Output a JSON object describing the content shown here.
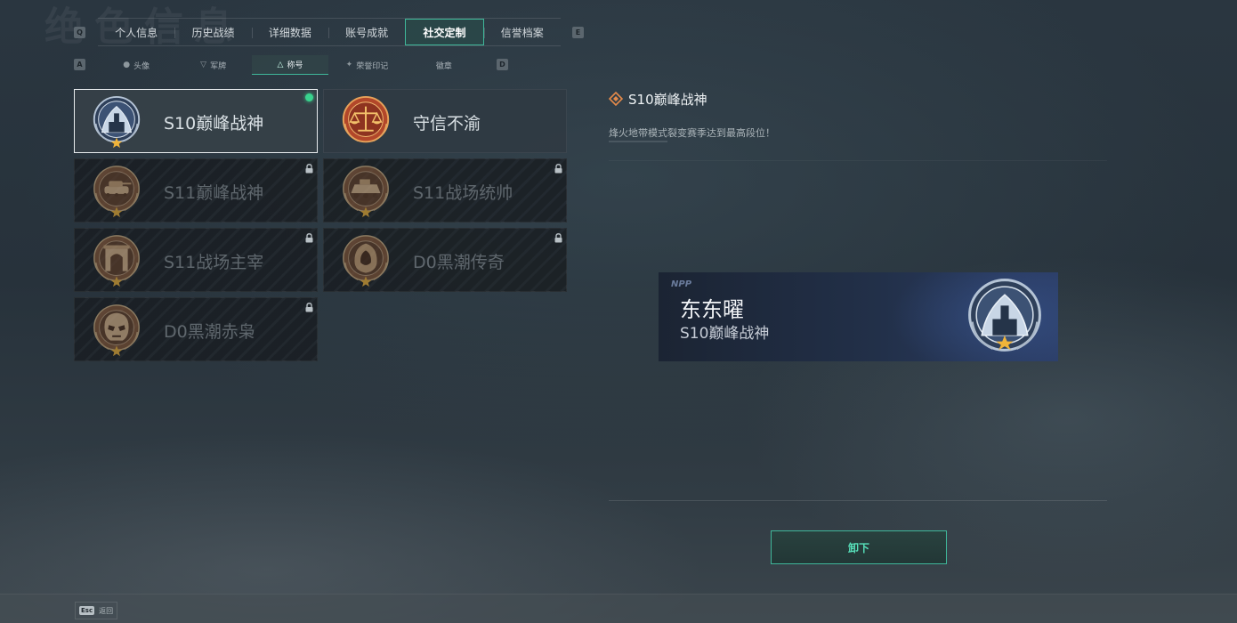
{
  "header": {
    "background_title": "绝色信息",
    "left_key": "Q",
    "right_key": "E",
    "tabs": [
      {
        "label": "个人信息",
        "active": false
      },
      {
        "label": "历史战绩",
        "active": false
      },
      {
        "label": "详细数据",
        "active": false
      },
      {
        "label": "账号成就",
        "active": false
      },
      {
        "label": "社交定制",
        "active": true
      },
      {
        "label": "信誉档案",
        "active": false
      }
    ]
  },
  "sub_nav": {
    "left_key": "A",
    "right_key": "D",
    "tabs": [
      {
        "label": "头像",
        "icon": "user-icon",
        "active": false
      },
      {
        "label": "军牌",
        "icon": "dogtag-icon",
        "active": false
      },
      {
        "label": "称号",
        "icon": "title-icon",
        "active": true
      },
      {
        "label": "荣誉印记",
        "icon": "honor-mark-icon",
        "active": false
      },
      {
        "label": "徽章",
        "icon": "",
        "active": false
      }
    ]
  },
  "titles": [
    {
      "name": "S10巅峰战神",
      "badge": "peak-warrior-badge",
      "state": "equipped",
      "equipped": true,
      "locked": false,
      "badge_color": "#9fb4cf"
    },
    {
      "name": "守信不渝",
      "badge": "scales-of-justice-badge",
      "state": "unlocked",
      "equipped": false,
      "locked": false,
      "badge_color": "#c45a2a"
    },
    {
      "name": "S11巅峰战神",
      "badge": "tank-badge",
      "state": "locked",
      "equipped": false,
      "locked": true,
      "badge_color": "#8a5a3a"
    },
    {
      "name": "S11战场统帅",
      "badge": "armored-vehicle-badge",
      "state": "locked",
      "equipped": false,
      "locked": true,
      "badge_color": "#8a5a3a"
    },
    {
      "name": "S11战场主宰",
      "badge": "arch-gate-badge",
      "state": "locked",
      "equipped": false,
      "locked": true,
      "badge_color": "#8a5a3a"
    },
    {
      "name": "D0黑潮传奇",
      "badge": "hooded-figure-badge",
      "state": "locked",
      "equipped": false,
      "locked": true,
      "badge_color": "#8a5a3a"
    },
    {
      "name": "D0黑潮赤枭",
      "badge": "skull-mask-badge",
      "state": "locked",
      "equipped": false,
      "locked": true,
      "badge_color": "#8a5a3a"
    }
  ],
  "detail": {
    "title": "S10巅峰战神",
    "description": "烽火地带模式裂变赛季达到最高段位！"
  },
  "preview": {
    "tag": "NPP",
    "player_name": "东东曜",
    "title": "S10巅峰战神"
  },
  "actions": {
    "unequip_label": "卸下"
  },
  "footer": {
    "esc_key": "Esc",
    "esc_label": "返回"
  },
  "colors": {
    "accent": "#3fb79a",
    "equipped_indicator": "#39d38e",
    "star": "#f0b43a"
  }
}
